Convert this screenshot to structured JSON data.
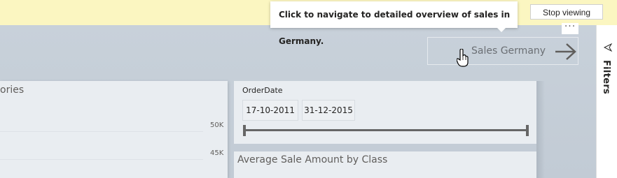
{
  "banner": {
    "stop_label": "Stop viewing"
  },
  "tooltip": {
    "text": "Click to navigate to detailed overview of sales in Germany."
  },
  "more_menu": {
    "label": "···"
  },
  "nav_button": {
    "label": "Sales Germany",
    "icon": "arrow-right-icon"
  },
  "filters_pane": {
    "label": "Filters",
    "icon": "filter-funnel-icon"
  },
  "left_visual": {
    "title_fragment": "ories",
    "ticks": [
      "50K",
      "45K"
    ]
  },
  "slicer": {
    "title": "OrderDate",
    "start_date": "17-10-2011",
    "end_date": "31-12-2015",
    "range_fraction": [
      0,
      1
    ]
  },
  "avg_visual": {
    "title": "Average Sale Amount by Class"
  },
  "colors": {
    "banner_bg": "#fbf6c1",
    "canvas_bg": "#c8d1da",
    "card_bg": "#e9edf1",
    "slider": "#666666"
  }
}
